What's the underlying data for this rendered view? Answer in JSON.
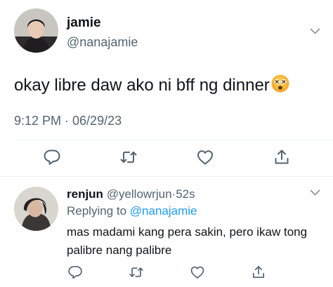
{
  "tweet": {
    "author_name": "jamie",
    "author_handle": "@nanajamie",
    "text": "okay libre daw ako ni bff ng dinner",
    "emoji": "dizzy-face-emoji",
    "timestamp": "9:12 PM · 06/29/23",
    "actions": [
      "reply-icon",
      "retweet-icon",
      "like-icon",
      "share-icon"
    ]
  },
  "reply": {
    "author_name": "renjun",
    "author_handle": "@yellowrjun",
    "separator": "·",
    "time_ago": "52s",
    "replying_label": "Replying to",
    "replying_handle": "@nanajamie",
    "text": "mas madami kang pera sakin, pero ikaw tong palibre nang palibre",
    "actions": [
      "reply-icon",
      "retweet-icon",
      "like-icon",
      "share-icon"
    ]
  },
  "colors": {
    "text": "#0f1419",
    "secondary": "#536471",
    "accent": "#1d9bf0",
    "divider": "#eff3f4"
  }
}
